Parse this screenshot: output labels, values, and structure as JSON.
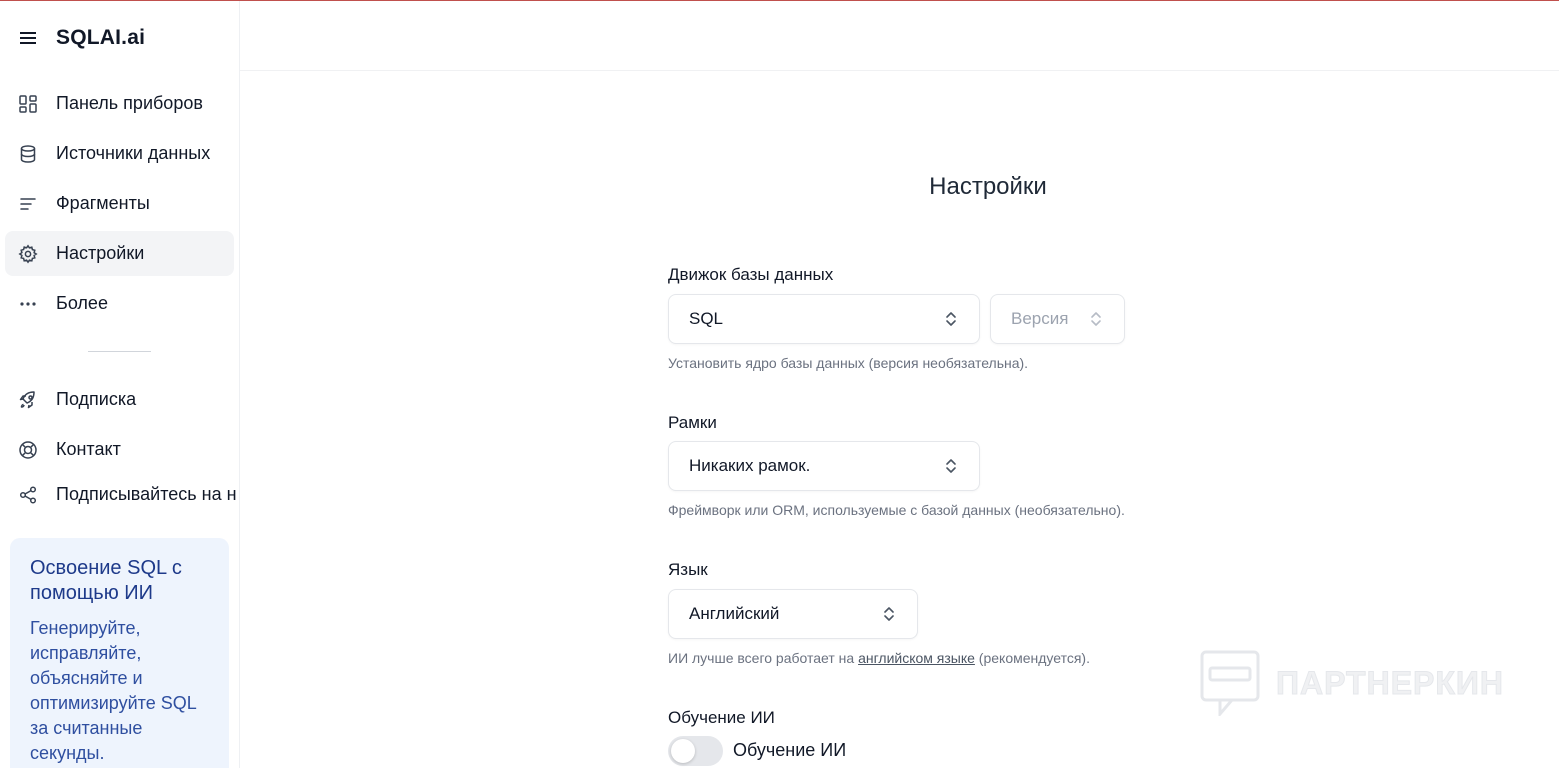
{
  "app": {
    "brand": "SQLAI.ai"
  },
  "sidebar": {
    "items": [
      {
        "label": "Панель приборов",
        "icon": "dashboard-icon"
      },
      {
        "label": "Источники данных",
        "icon": "database-icon"
      },
      {
        "label": "Фрагменты",
        "icon": "lines-icon"
      },
      {
        "label": "Настройки",
        "icon": "gear-icon",
        "active": true
      },
      {
        "label": "Более",
        "icon": "more-icon"
      },
      {
        "label": "Подписка",
        "icon": "rocket-icon"
      },
      {
        "label": "Контакт",
        "icon": "lifebuoy-icon"
      },
      {
        "label": "Подписывайтесь на н",
        "icon": "share-icon"
      }
    ],
    "promo": {
      "title": "Освоение SQL с помощью ИИ",
      "body": "Генерируйте, исправляйте, объясняйте и оптимизируйте SQL за считанные секунды."
    }
  },
  "main": {
    "title": "Настройки",
    "engine": {
      "label": "Движок базы данных",
      "value": "SQL",
      "version_placeholder": "Версия",
      "hint": "Установить ядро базы данных (версия необязательна)."
    },
    "framework": {
      "label": "Рамки",
      "value": "Никаких рамок.",
      "hint": "Фреймворк или ORM, используемые с базой данных (необязательно)."
    },
    "language": {
      "label": "Язык",
      "value": "Английский",
      "hint_before": "ИИ лучше всего работает на ",
      "hint_link": "английском языке",
      "hint_after": " (рекомендуется)."
    },
    "training": {
      "label": "Обучение ИИ",
      "toggle_label": "Обучение ИИ",
      "enabled": false
    }
  },
  "watermark": {
    "text": "ПАРТНЕРКИН"
  },
  "colors": {
    "accent": "#1e3a8a",
    "promo_bg": "#eef4fd",
    "active_bg": "#f3f4f6"
  }
}
